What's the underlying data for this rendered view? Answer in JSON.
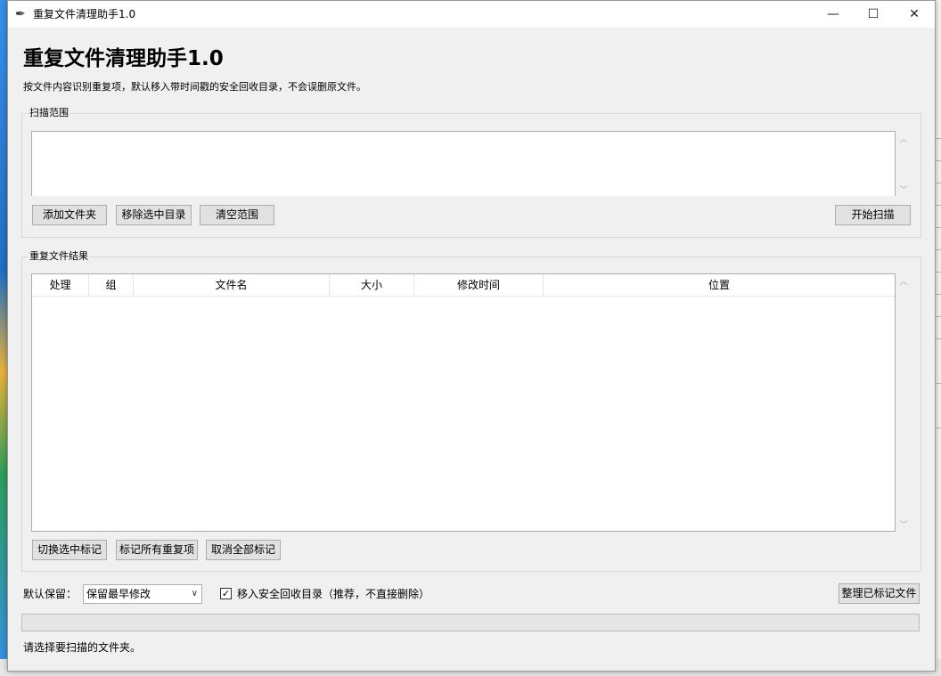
{
  "window": {
    "title": "重复文件清理助手1.0",
    "min": "—",
    "max": "☐",
    "close": "✕"
  },
  "header": {
    "title": "重复文件清理助手1.0",
    "subtitle": "按文件内容识别重复项，默认移入带时间戳的安全回收目录，不会误删原文件。"
  },
  "scan": {
    "label": "扫描范围",
    "folders": [],
    "add_label": "添加文件夹",
    "remove_label": "移除选中目录",
    "clear_label": "清空范围",
    "start_label": "开始扫描"
  },
  "results": {
    "label": "重复文件结果",
    "columns": [
      "处理",
      "组",
      "文件名",
      "大小",
      "修改时间",
      "位置"
    ],
    "rows": [],
    "toggle_label": "切换选中标记",
    "mark_all_label": "标记所有重复项",
    "unmark_all_label": "取消全部标记"
  },
  "options": {
    "keep_label": "默认保留：",
    "keep_value": "保留最早修改",
    "move_checked": true,
    "check_mark": "✓",
    "move_label": "移入安全回收目录（推荐，不直接删除）",
    "organize_label": "整理已标记文件"
  },
  "progress": {
    "value": 0
  },
  "status": "请选择要扫描的文件夹。",
  "colors": {
    "window_bg": "#f0f0f0",
    "progress_fill": "#06b025"
  },
  "icons": {
    "app": "feather-icon",
    "dropdown": "chevron-down-icon"
  }
}
